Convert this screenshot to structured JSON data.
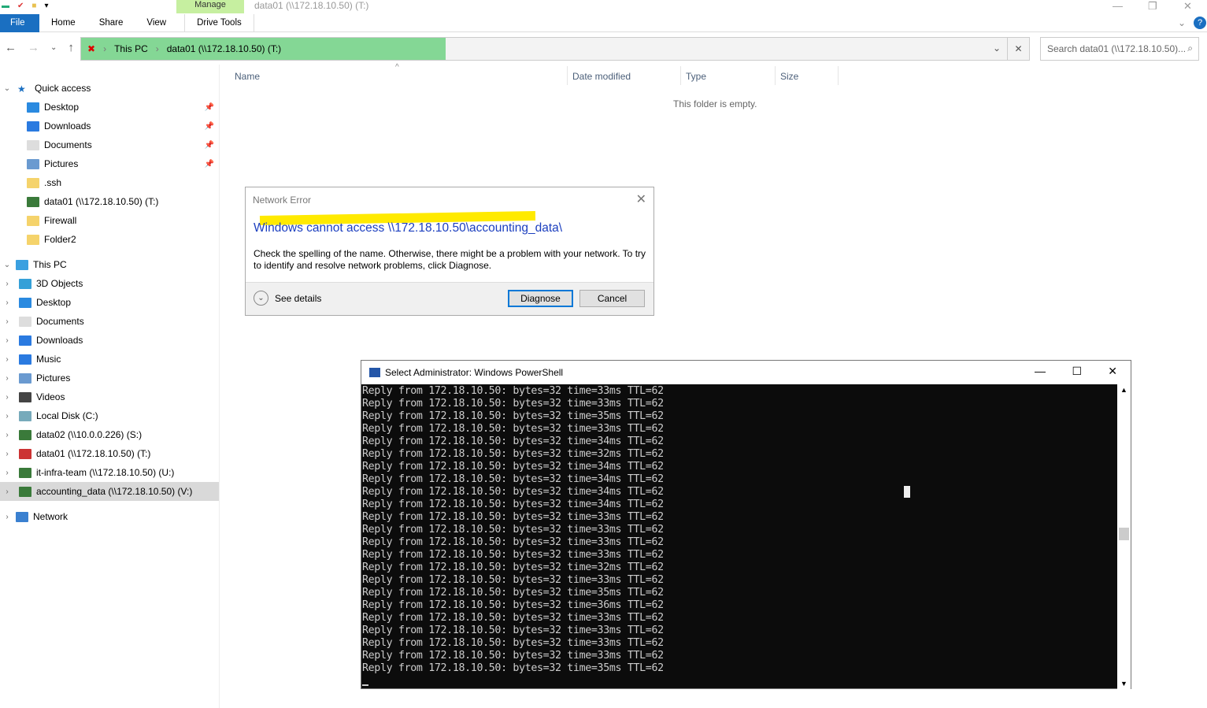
{
  "window": {
    "title": "data01 (\\\\172.18.10.50) (T:)",
    "manage": "Manage"
  },
  "ribbon": {
    "tabs": [
      "File",
      "Home",
      "Share",
      "View",
      "Drive Tools"
    ]
  },
  "address": {
    "crumbs": [
      "This PC",
      "data01 (\\\\172.18.10.50) (T:)"
    ],
    "search_placeholder": "Search data01 (\\\\172.18.10.50)..."
  },
  "sidebar": {
    "quick_access": "Quick access",
    "quick_items": [
      "Desktop",
      "Downloads",
      "Documents",
      "Pictures",
      ".ssh",
      "data01 (\\\\172.18.10.50) (T:)",
      "Firewall",
      "Folder2"
    ],
    "this_pc": "This PC",
    "pc_items": [
      "3D Objects",
      "Desktop",
      "Documents",
      "Downloads",
      "Music",
      "Pictures",
      "Videos",
      "Local Disk (C:)",
      "data02 (\\\\10.0.0.226) (S:)",
      "data01 (\\\\172.18.10.50) (T:)",
      "it-infra-team (\\\\172.18.10.50) (U:)",
      "accounting_data (\\\\172.18.10.50) (V:)"
    ],
    "network": "Network"
  },
  "content": {
    "columns": [
      "Name",
      "Date modified",
      "Type",
      "Size"
    ],
    "empty": "This folder is empty."
  },
  "dialog": {
    "title": "Network Error",
    "heading": "Windows cannot access \\\\172.18.10.50\\accounting_data\\",
    "body": "Check the spelling of the name. Otherwise, there might be a problem with your network. To try to identify and resolve network problems, click Diagnose.",
    "details": "See details",
    "diagnose": "Diagnose",
    "cancel": "Cancel"
  },
  "powershell": {
    "title": "Select Administrator: Windows PowerShell",
    "ip": "172.18.10.50",
    "bytes": 32,
    "ttl": 62,
    "times_ms": [
      33,
      33,
      35,
      33,
      34,
      32,
      34,
      34,
      34,
      34,
      33,
      33,
      33,
      33,
      32,
      33,
      35,
      36,
      33,
      33,
      33,
      33,
      35
    ]
  }
}
